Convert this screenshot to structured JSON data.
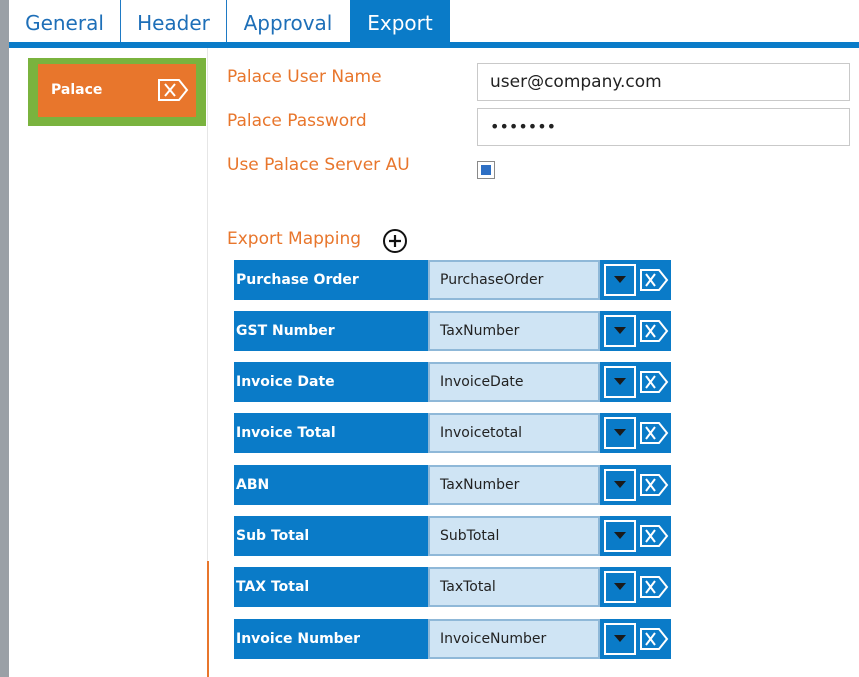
{
  "tabs": [
    {
      "label": "General"
    },
    {
      "label": "Header"
    },
    {
      "label": "Approval"
    },
    {
      "label": "Export"
    }
  ],
  "active_tab": "Export",
  "exporters": [
    {
      "label": "Palace"
    }
  ],
  "form": {
    "user_name_label": "Palace User Name",
    "user_name_value": "user@company.com",
    "password_label": "Palace Password",
    "password_value": "•••••••",
    "server_au_label": "Use Palace Server AU",
    "server_au_checked": true
  },
  "export_mapping": {
    "title": "Export Mapping",
    "rows": [
      {
        "field": "Purchase Order",
        "value": "PurchaseOrder"
      },
      {
        "field": "GST Number",
        "value": "TaxNumber"
      },
      {
        "field": "Invoice Date",
        "value": "InvoiceDate"
      },
      {
        "field": "Invoice Total",
        "value": "Invoicetotal"
      },
      {
        "field": "ABN",
        "value": "TaxNumber"
      },
      {
        "field": "Sub Total",
        "value": "SubTotal"
      },
      {
        "field": "TAX Total",
        "value": "TaxTotal"
      },
      {
        "field": "Invoice Number",
        "value": "InvoiceNumber"
      }
    ]
  },
  "colors": {
    "accent_blue": "#0a7bc8",
    "orange": "#e8762c",
    "green": "#7ab33e",
    "value_bg": "#cfe4f4"
  },
  "icons": {
    "add": "add-circle-icon",
    "remove": "remove-x-icon",
    "dropdown": "chevron-down-icon"
  }
}
